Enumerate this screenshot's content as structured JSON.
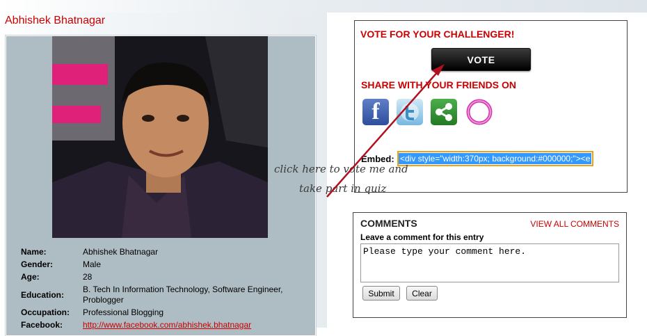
{
  "profile": {
    "title": "Abhishek Bhatnagar",
    "fields": [
      {
        "label": "Name:",
        "value": "Abhishek Bhatnagar"
      },
      {
        "label": "Gender:",
        "value": "Male"
      },
      {
        "label": "Age:",
        "value": "28"
      },
      {
        "label": "Education:",
        "value": "B. Tech In Information Technology, Software Engineer, Problogger"
      },
      {
        "label": "Occupation:",
        "value": "Professional Blogging"
      },
      {
        "label": "Facebook:",
        "value": "http://www.facebook.com/abhishek.bhatnagar"
      }
    ]
  },
  "vote": {
    "heading": "VOTE FOR YOUR CHALLENGER!",
    "button": "VOTE"
  },
  "share": {
    "heading": "SHARE WITH YOUR FRIENDS ON",
    "icons": [
      "facebook-icon",
      "twitter-icon",
      "share-icon",
      "orkut-icon"
    ],
    "facebook_glyph": "f"
  },
  "embed": {
    "label": "Embed:",
    "value": "<div style=\"width:370px; background:#000000;\"><e"
  },
  "comments": {
    "heading": "COMMENTS",
    "view_all": "VIEW ALL COMMENTS",
    "leave_label": "Leave a comment for this entry",
    "placeholder": "Please type your comment here.",
    "submit": "Submit",
    "clear": "Clear"
  },
  "annotation": {
    "line1": "click here to vote me and",
    "line2": "take part in quiz"
  },
  "colors": {
    "accent": "#cc0000",
    "panel": "#aebcc3",
    "embed_border": "#e8a317",
    "selection": "#3399ff"
  }
}
